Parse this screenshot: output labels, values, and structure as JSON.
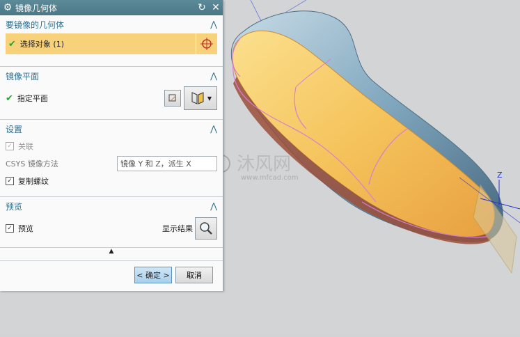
{
  "dialog": {
    "title": "镜像几何体",
    "sections": {
      "geometry": {
        "header": "要镜像的几何体",
        "select_label": "选择对象 (1)"
      },
      "plane": {
        "header": "镜像平面",
        "specify_label": "指定平面"
      },
      "settings": {
        "header": "设置",
        "associative_label": "关联",
        "csys_label": "CSYS 镜像方法",
        "csys_value": "镜像 Y 和 Z，派生 X",
        "copy_threads_label": "复制螺纹"
      },
      "preview": {
        "header": "预览",
        "preview_label": "预览",
        "show_result_label": "显示结果"
      }
    },
    "footer": {
      "ok_label": "< 确定 >",
      "cancel_label": "取消"
    }
  },
  "watermark": {
    "brand": "沐风网",
    "url": "www.mfcad.com"
  },
  "viewport": {
    "csys_label": "Z"
  },
  "colors": {
    "title_bg": "#5b8896",
    "section_header": "#2f6f8f",
    "selection_bg": "#f8d27a",
    "model_yellow": "#f5c35b",
    "model_blue": "#7fa6bd",
    "curve_pink": "#d87fd0"
  }
}
